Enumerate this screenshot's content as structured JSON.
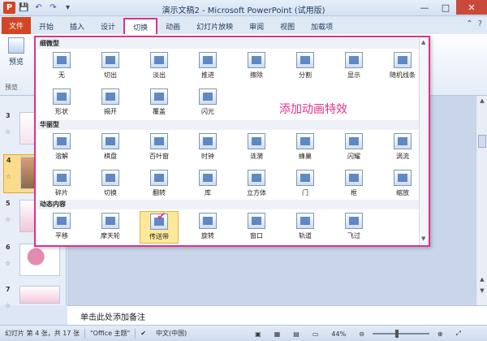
{
  "window": {
    "title": "演示文稿2 - Microsoft PowerPoint (试用版)",
    "controls": [
      "—",
      "□",
      "✕"
    ]
  },
  "qat": {
    "app_icon": "P",
    "save": "💾",
    "undo": "↶",
    "redo": "↷",
    "more": "▾"
  },
  "tabs": [
    {
      "label": "文件"
    },
    {
      "label": "开始"
    },
    {
      "label": "插入"
    },
    {
      "label": "设计"
    },
    {
      "label": "切换"
    },
    {
      "label": "动画"
    },
    {
      "label": "幻灯片放映"
    },
    {
      "label": "审阅"
    },
    {
      "label": "视图"
    },
    {
      "label": "加载项"
    }
  ],
  "ribbon": {
    "preview_label": "预览",
    "group_label": "预览"
  },
  "gallery": {
    "annotation": "添加动画特效",
    "sections": [
      {
        "title": "细微型",
        "items": [
          "无",
          "切出",
          "淡出",
          "推进",
          "擦除",
          "分割",
          "显示",
          "随机线条",
          "形状",
          "揭开",
          "覆盖",
          "闪光"
        ]
      },
      {
        "title": "华丽型",
        "items": [
          "溶解",
          "棋盘",
          "百叶窗",
          "时钟",
          "涟漪",
          "蜂巢",
          "闪耀",
          "涡流",
          "碎片",
          "切换",
          "翻转",
          "库",
          "立方体",
          "门",
          "框",
          "缩放"
        ]
      },
      {
        "title": "动态内容",
        "items": [
          "平移",
          "摩天轮",
          "传送带",
          "旋转",
          "窗口",
          "轨道",
          "飞过"
        ]
      }
    ],
    "selected": "传送带"
  },
  "slides_pane": {
    "thumbs": [
      {
        "num": "3",
        "star": "☆"
      },
      {
        "num": "4",
        "star": "☆"
      },
      {
        "num": "5",
        "star": "☆"
      },
      {
        "num": "6",
        "star": "☆"
      },
      {
        "num": "7",
        "star": "☆"
      }
    ]
  },
  "notes": {
    "placeholder": "单击此处添加备注"
  },
  "status": {
    "slide_info": "幻灯片 第 4 张，共 17 张",
    "theme": "\"Office 主题\"",
    "language": "中文(中国)",
    "zoom": "44%"
  }
}
